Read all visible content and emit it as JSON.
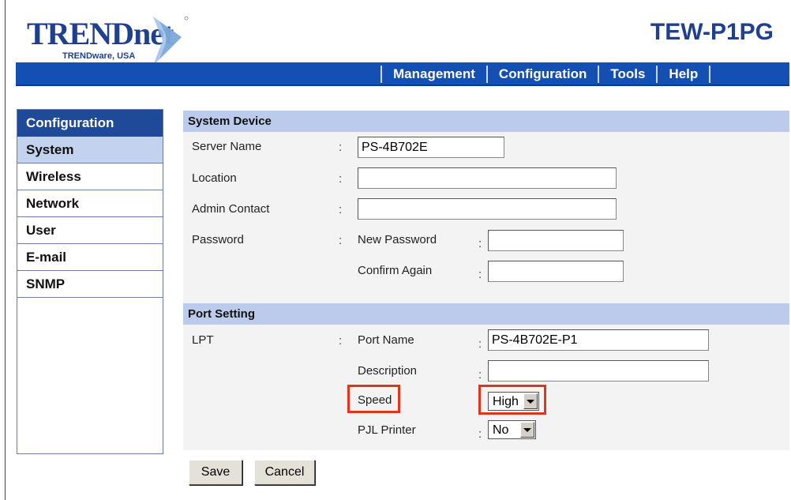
{
  "header": {
    "logo_text": "TRENDnet",
    "logo_subtext": "TRENDware, USA",
    "model": "TEW-P1PG",
    "nav": [
      "Management",
      "Configuration",
      "Tools",
      "Help"
    ]
  },
  "sidebar": {
    "title": "Configuration",
    "items": [
      {
        "label": "System",
        "active": true
      },
      {
        "label": "Wireless",
        "active": false
      },
      {
        "label": "Network",
        "active": false
      },
      {
        "label": "User",
        "active": false
      },
      {
        "label": "E-mail",
        "active": false
      },
      {
        "label": "SNMP",
        "active": false
      }
    ]
  },
  "system_device": {
    "title": "System Device",
    "server_name_label": "Server Name",
    "server_name_value": "PS-4B702E",
    "location_label": "Location",
    "location_value": "",
    "admin_contact_label": "Admin Contact",
    "admin_contact_value": "",
    "password_label": "Password",
    "new_password_label": "New Password",
    "confirm_again_label": "Confirm Again"
  },
  "port_setting": {
    "title": "Port Setting",
    "lpt_label": "LPT",
    "port_name_label": "Port Name",
    "port_name_value": "PS-4B702E-P1",
    "description_label": "Description",
    "description_value": "",
    "speed_label": "Speed",
    "speed_value": "High",
    "pjl_label": "PJL Printer",
    "pjl_value": "No"
  },
  "buttons": {
    "save": "Save",
    "cancel": "Cancel"
  },
  "colors": {
    "brand_blue": "#1f3f8f",
    "nav_blue": "#1450b4",
    "section_bg": "#bccbec",
    "highlight_red": "#e0341c"
  }
}
